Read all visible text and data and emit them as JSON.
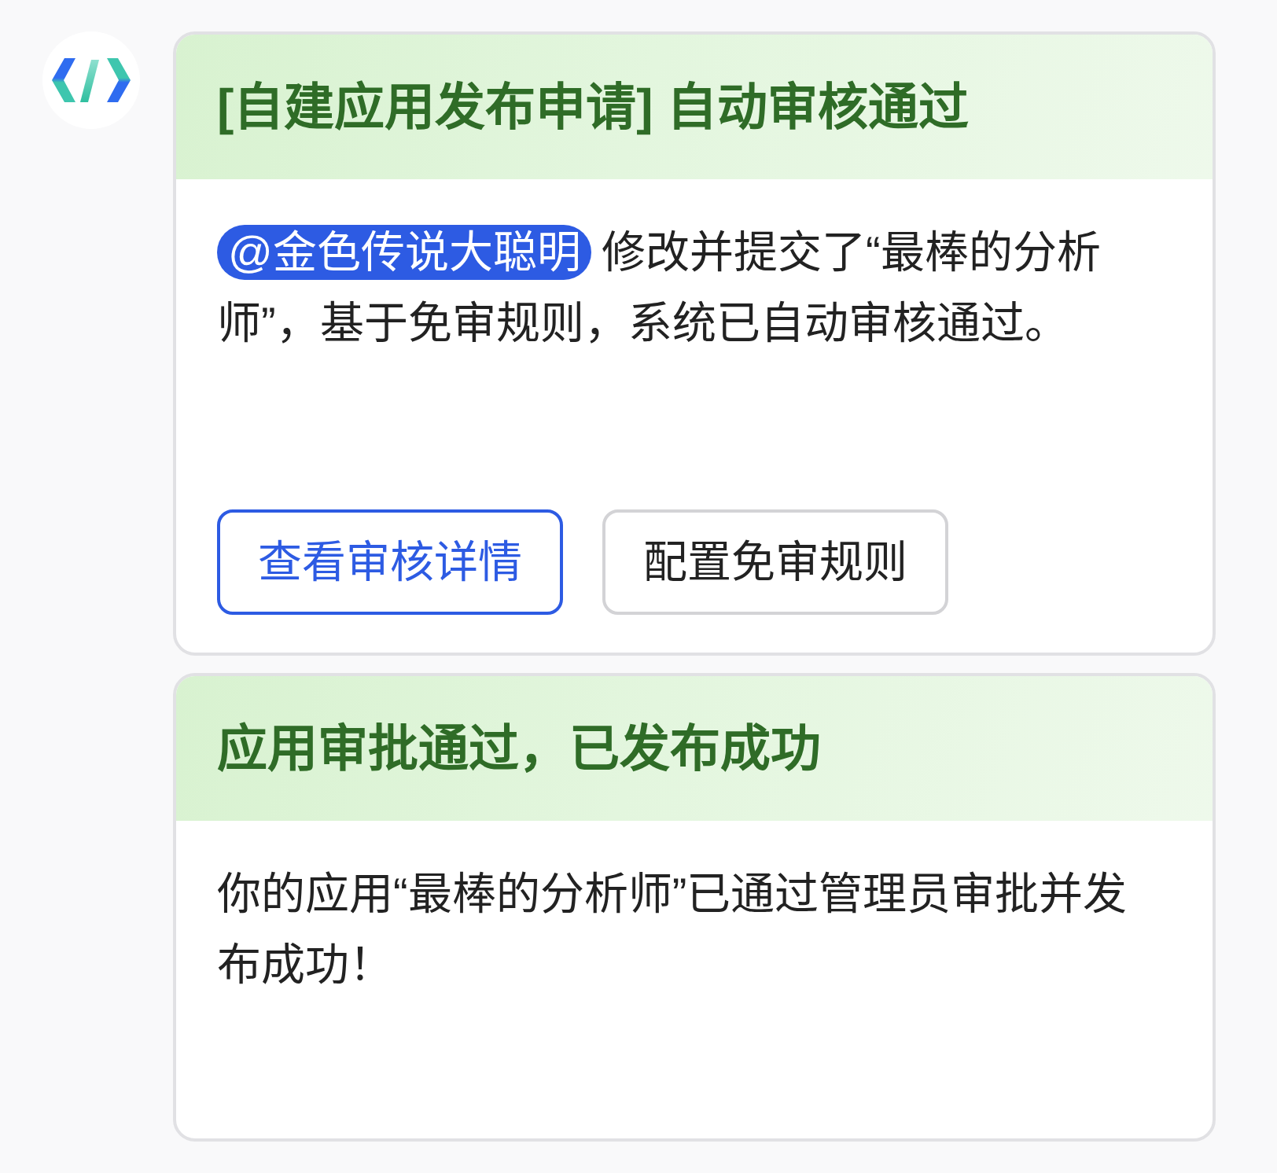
{
  "messages": [
    {
      "title": "[自建应用发布申请] 自动审核通过",
      "mention": "@金色传说大聪明",
      "text": "修改并提交了“最棒的分析师”，基于免审规则，系统已自动审核通过。",
      "buttons": [
        {
          "label": "查看审核详情",
          "kind": "primary"
        },
        {
          "label": "配置免审规则",
          "kind": "default"
        }
      ]
    },
    {
      "title": "应用审批通过，已发布成功",
      "text": "你的应用“最棒的分析师”已通过管理员审批并发布成功！"
    }
  ]
}
